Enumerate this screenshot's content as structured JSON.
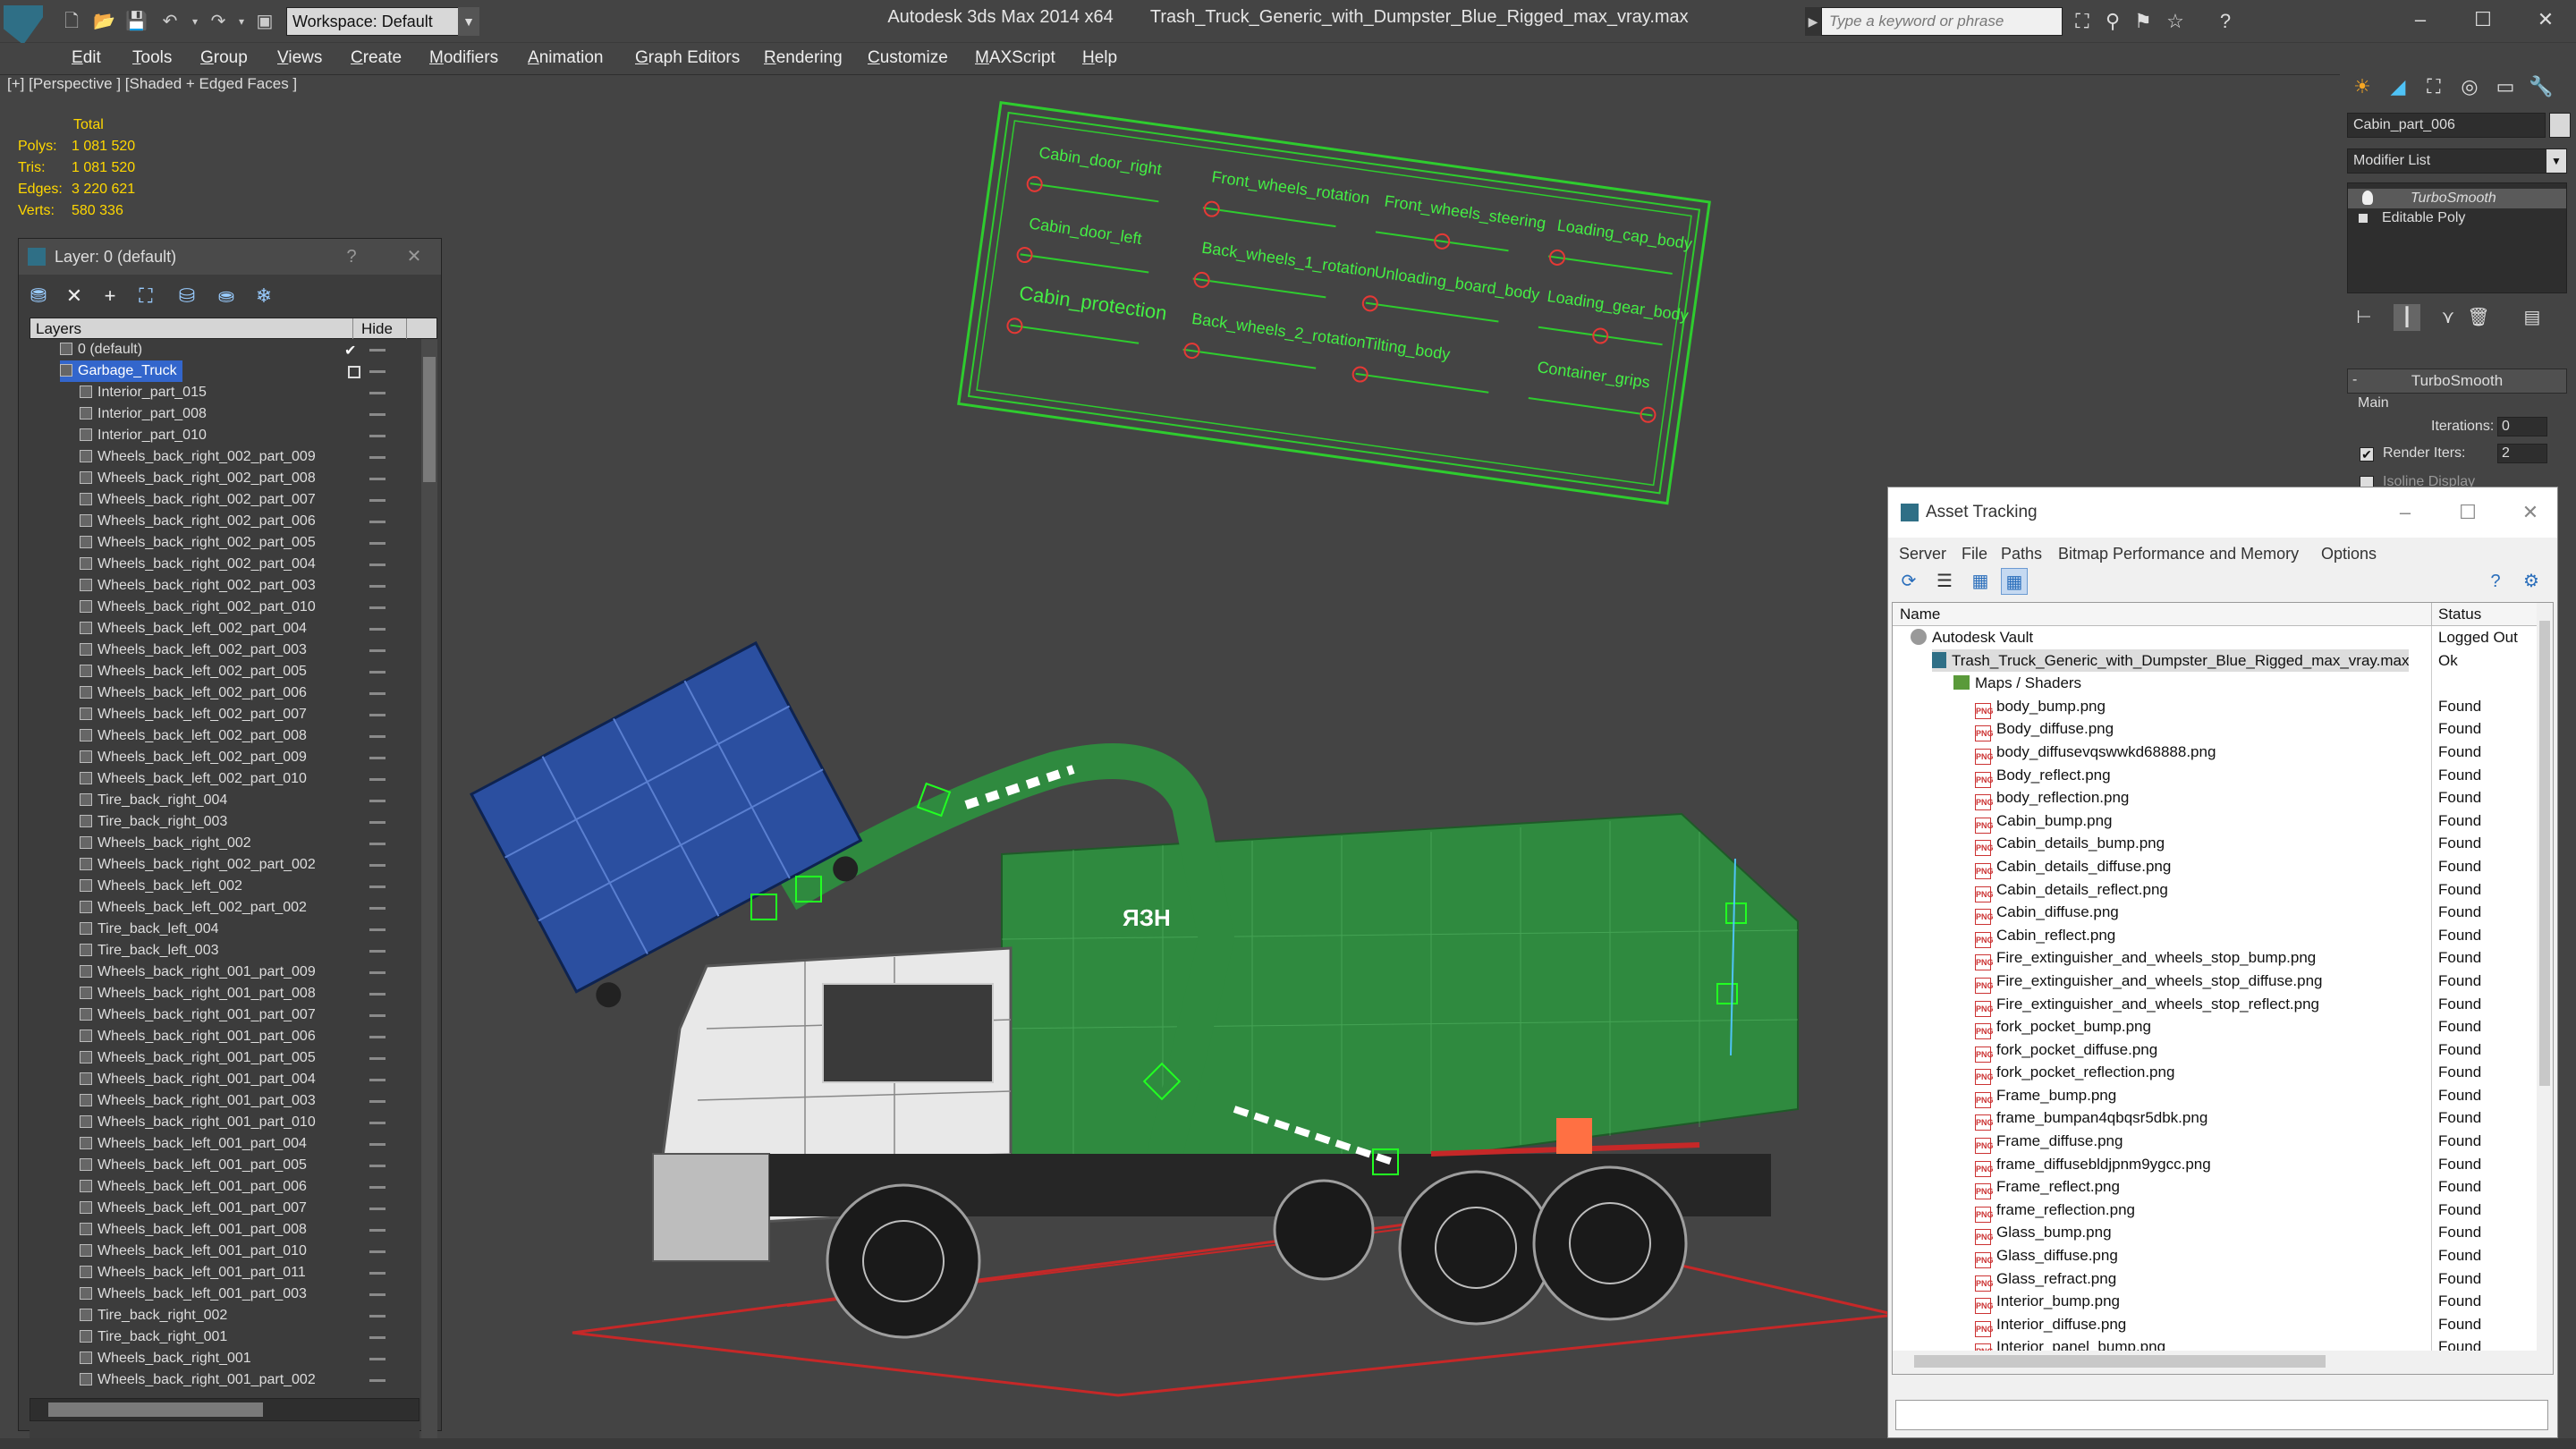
{
  "titlebar": {
    "app_name": "Autodesk 3ds Max  2014 x64",
    "file_name": "Trash_Truck_Generic_with_Dumpster_Blue_Rigged_max_vray.max",
    "workspace": "Workspace: Default",
    "search_placeholder": "Type a keyword or phrase"
  },
  "menu": [
    "Edit",
    "Tools",
    "Group",
    "Views",
    "Create",
    "Modifiers",
    "Animation",
    "Graph Editors",
    "Rendering",
    "Customize",
    "MAXScript",
    "Help"
  ],
  "viewport": {
    "label": "[+] [Perspective ] [Shaded + Edged Faces ]",
    "stats_title": "Total",
    "stats": [
      {
        "label": "Polys:",
        "value": "1 081 520"
      },
      {
        "label": "Tris:",
        "value": "1 081 520"
      },
      {
        "label": "Edges:",
        "value": "3 220 621"
      },
      {
        "label": "Verts:",
        "value": "580 336"
      }
    ],
    "rig_labels": [
      "Cabin_door_right",
      "Front_wheels_rotation",
      "Front_wheels_steering",
      "Loading_cap_body",
      "Cabin_door_left",
      "Back_wheels_1_rotation",
      "Unloading_board_body",
      "Loading_gear_body",
      "Cabin_protection",
      "Back_wheels_2_rotation",
      "Tilting_body",
      "Container_grips"
    ],
    "truck_logo": "ЯЗН"
  },
  "layer_panel": {
    "title": "Layer: 0 (default)",
    "help": "?",
    "col_layers": "Layers",
    "col_hide": "Hide",
    "rows": [
      {
        "name": "0 (default)",
        "level": 1,
        "kind": "layer"
      },
      {
        "name": "Garbage_Truck",
        "level": 1,
        "kind": "layer",
        "selected": true
      },
      {
        "name": "Interior_part_015",
        "level": 2
      },
      {
        "name": "Interior_part_008",
        "level": 2
      },
      {
        "name": "Interior_part_010",
        "level": 2
      },
      {
        "name": "Wheels_back_right_002_part_009",
        "level": 2
      },
      {
        "name": "Wheels_back_right_002_part_008",
        "level": 2
      },
      {
        "name": "Wheels_back_right_002_part_007",
        "level": 2
      },
      {
        "name": "Wheels_back_right_002_part_006",
        "level": 2
      },
      {
        "name": "Wheels_back_right_002_part_005",
        "level": 2
      },
      {
        "name": "Wheels_back_right_002_part_004",
        "level": 2
      },
      {
        "name": "Wheels_back_right_002_part_003",
        "level": 2
      },
      {
        "name": "Wheels_back_right_002_part_010",
        "level": 2
      },
      {
        "name": "Wheels_back_left_002_part_004",
        "level": 2
      },
      {
        "name": "Wheels_back_left_002_part_003",
        "level": 2
      },
      {
        "name": "Wheels_back_left_002_part_005",
        "level": 2
      },
      {
        "name": "Wheels_back_left_002_part_006",
        "level": 2
      },
      {
        "name": "Wheels_back_left_002_part_007",
        "level": 2
      },
      {
        "name": "Wheels_back_left_002_part_008",
        "level": 2
      },
      {
        "name": "Wheels_back_left_002_part_009",
        "level": 2
      },
      {
        "name": "Wheels_back_left_002_part_010",
        "level": 2
      },
      {
        "name": "Tire_back_right_004",
        "level": 2
      },
      {
        "name": "Tire_back_right_003",
        "level": 2
      },
      {
        "name": "Wheels_back_right_002",
        "level": 2
      },
      {
        "name": "Wheels_back_right_002_part_002",
        "level": 2
      },
      {
        "name": "Wheels_back_left_002",
        "level": 2
      },
      {
        "name": "Wheels_back_left_002_part_002",
        "level": 2
      },
      {
        "name": "Tire_back_left_004",
        "level": 2
      },
      {
        "name": "Tire_back_left_003",
        "level": 2
      },
      {
        "name": "Wheels_back_right_001_part_009",
        "level": 2
      },
      {
        "name": "Wheels_back_right_001_part_008",
        "level": 2
      },
      {
        "name": "Wheels_back_right_001_part_007",
        "level": 2
      },
      {
        "name": "Wheels_back_right_001_part_006",
        "level": 2
      },
      {
        "name": "Wheels_back_right_001_part_005",
        "level": 2
      },
      {
        "name": "Wheels_back_right_001_part_004",
        "level": 2
      },
      {
        "name": "Wheels_back_right_001_part_003",
        "level": 2
      },
      {
        "name": "Wheels_back_right_001_part_010",
        "level": 2
      },
      {
        "name": "Wheels_back_left_001_part_004",
        "level": 2
      },
      {
        "name": "Wheels_back_left_001_part_005",
        "level": 2
      },
      {
        "name": "Wheels_back_left_001_part_006",
        "level": 2
      },
      {
        "name": "Wheels_back_left_001_part_007",
        "level": 2
      },
      {
        "name": "Wheels_back_left_001_part_008",
        "level": 2
      },
      {
        "name": "Wheels_back_left_001_part_010",
        "level": 2
      },
      {
        "name": "Wheels_back_left_001_part_011",
        "level": 2
      },
      {
        "name": "Wheels_back_left_001_part_003",
        "level": 2
      },
      {
        "name": "Tire_back_right_002",
        "level": 2
      },
      {
        "name": "Tire_back_right_001",
        "level": 2
      },
      {
        "name": "Wheels_back_right_001",
        "level": 2
      },
      {
        "name": "Wheels_back_right_001_part_002",
        "level": 2
      }
    ]
  },
  "command_panel": {
    "object_name": "Cabin_part_006",
    "modifier_list": "Modifier List",
    "stack": [
      "TurboSmooth",
      "Editable Poly"
    ],
    "rollout_title": "TurboSmooth",
    "group_main": "Main",
    "iterations_label": "Iterations:",
    "iterations_value": "0",
    "render_iters_label": "Render Iters:",
    "render_iters_value": "2",
    "isoline_label": "Isoline Display"
  },
  "asset_tracking": {
    "title": "Asset Tracking",
    "menu": [
      "Server",
      "File",
      "Paths",
      "Bitmap Performance and Memory",
      "Options"
    ],
    "col_name": "Name",
    "col_status": "Status",
    "rows": [
      {
        "name": "Autodesk Vault",
        "status": "Logged Out",
        "indent": 0,
        "icon": "vault"
      },
      {
        "name": "Trash_Truck_Generic_with_Dumpster_Blue_Rigged_max_vray.max",
        "status": "Ok",
        "indent": 1,
        "icon": "max"
      },
      {
        "name": "Maps / Shaders",
        "status": "",
        "indent": 2,
        "icon": "folder"
      },
      {
        "name": "body_bump.png",
        "status": "Found",
        "indent": 3,
        "icon": "png"
      },
      {
        "name": "Body_diffuse.png",
        "status": "Found",
        "indent": 3,
        "icon": "png"
      },
      {
        "name": "body_diffusevqswwkd68888.png",
        "status": "Found",
        "indent": 3,
        "icon": "png"
      },
      {
        "name": "Body_reflect.png",
        "status": "Found",
        "indent": 3,
        "icon": "png"
      },
      {
        "name": "body_reflection.png",
        "status": "Found",
        "indent": 3,
        "icon": "png"
      },
      {
        "name": "Cabin_bump.png",
        "status": "Found",
        "indent": 3,
        "icon": "png"
      },
      {
        "name": "Cabin_details_bump.png",
        "status": "Found",
        "indent": 3,
        "icon": "png"
      },
      {
        "name": "Cabin_details_diffuse.png",
        "status": "Found",
        "indent": 3,
        "icon": "png"
      },
      {
        "name": "Cabin_details_reflect.png",
        "status": "Found",
        "indent": 3,
        "icon": "png"
      },
      {
        "name": "Cabin_diffuse.png",
        "status": "Found",
        "indent": 3,
        "icon": "png"
      },
      {
        "name": "Cabin_reflect.png",
        "status": "Found",
        "indent": 3,
        "icon": "png"
      },
      {
        "name": "Fire_extinguisher_and_wheels_stop_bump.png",
        "status": "Found",
        "indent": 3,
        "icon": "png"
      },
      {
        "name": "Fire_extinguisher_and_wheels_stop_diffuse.png",
        "status": "Found",
        "indent": 3,
        "icon": "png"
      },
      {
        "name": "Fire_extinguisher_and_wheels_stop_reflect.png",
        "status": "Found",
        "indent": 3,
        "icon": "png"
      },
      {
        "name": "fork_pocket_bump.png",
        "status": "Found",
        "indent": 3,
        "icon": "png"
      },
      {
        "name": "fork_pocket_diffuse.png",
        "status": "Found",
        "indent": 3,
        "icon": "png"
      },
      {
        "name": "fork_pocket_reflection.png",
        "status": "Found",
        "indent": 3,
        "icon": "png"
      },
      {
        "name": "Frame_bump.png",
        "status": "Found",
        "indent": 3,
        "icon": "png"
      },
      {
        "name": "frame_bumpan4qbqsr5dbk.png",
        "status": "Found",
        "indent": 3,
        "icon": "png"
      },
      {
        "name": "Frame_diffuse.png",
        "status": "Found",
        "indent": 3,
        "icon": "png"
      },
      {
        "name": "frame_diffusebldjpnm9ygcc.png",
        "status": "Found",
        "indent": 3,
        "icon": "png"
      },
      {
        "name": "Frame_reflect.png",
        "status": "Found",
        "indent": 3,
        "icon": "png"
      },
      {
        "name": "frame_reflection.png",
        "status": "Found",
        "indent": 3,
        "icon": "png"
      },
      {
        "name": "Glass_bump.png",
        "status": "Found",
        "indent": 3,
        "icon": "png"
      },
      {
        "name": "Glass_diffuse.png",
        "status": "Found",
        "indent": 3,
        "icon": "png"
      },
      {
        "name": "Glass_refract.png",
        "status": "Found",
        "indent": 3,
        "icon": "png"
      },
      {
        "name": "Interior_bump.png",
        "status": "Found",
        "indent": 3,
        "icon": "png"
      },
      {
        "name": "Interior_diffuse.png",
        "status": "Found",
        "indent": 3,
        "icon": "png"
      },
      {
        "name": "Interior_panel_bump.png",
        "status": "Found",
        "indent": 3,
        "icon": "png"
      }
    ]
  },
  "colors": {
    "ui_bg": "#444444",
    "viewport_bg": "#444444",
    "selection_blue": "#3366cc",
    "rig_green": "#22cc22",
    "truck_green": "#2e8b3e",
    "stats_yellow": "#ffd700"
  }
}
